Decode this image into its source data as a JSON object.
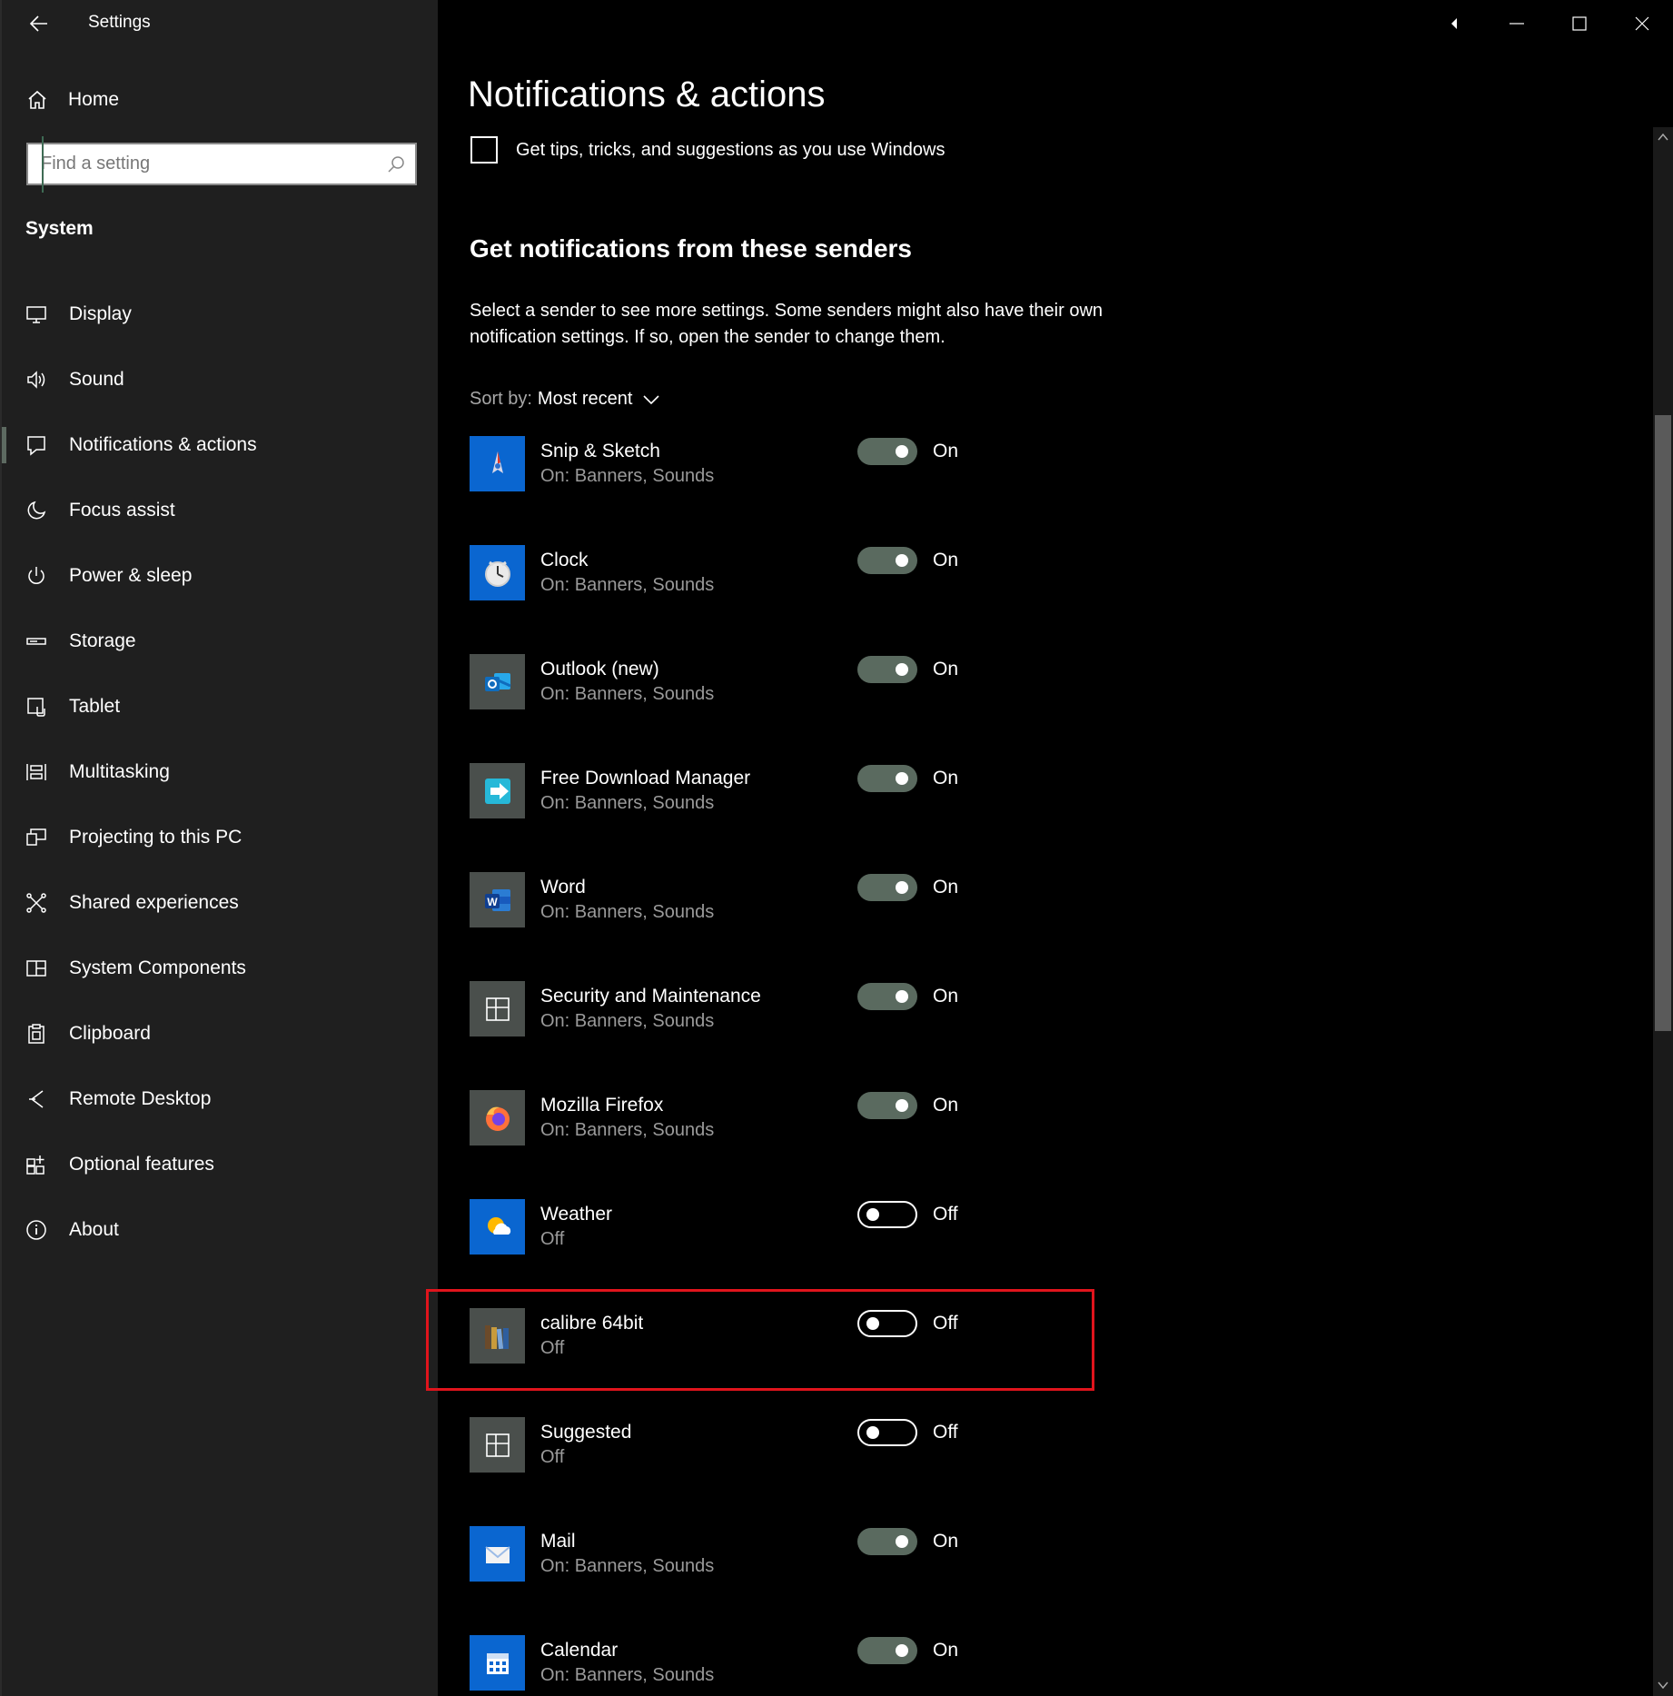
{
  "window": {
    "title": "Settings"
  },
  "nav": {
    "home_label": "Home",
    "search_placeholder": "Find a setting",
    "section": "System",
    "items": [
      {
        "label": "Display",
        "icon": "display-icon"
      },
      {
        "label": "Sound",
        "icon": "speaker-icon"
      },
      {
        "label": "Notifications & actions",
        "icon": "notification-icon",
        "selected": true
      },
      {
        "label": "Focus assist",
        "icon": "moon-icon"
      },
      {
        "label": "Power & sleep",
        "icon": "power-icon"
      },
      {
        "label": "Storage",
        "icon": "storage-icon"
      },
      {
        "label": "Tablet",
        "icon": "tablet-icon"
      },
      {
        "label": "Multitasking",
        "icon": "multitasking-icon"
      },
      {
        "label": "Projecting to this PC",
        "icon": "projecting-icon"
      },
      {
        "label": "Shared experiences",
        "icon": "shared-experiences-icon"
      },
      {
        "label": "System Components",
        "icon": "system-components-icon"
      },
      {
        "label": "Clipboard",
        "icon": "clipboard-icon"
      },
      {
        "label": "Remote Desktop",
        "icon": "remote-desktop-icon"
      },
      {
        "label": "Optional features",
        "icon": "optional-features-icon"
      },
      {
        "label": "About",
        "icon": "info-icon"
      }
    ]
  },
  "content": {
    "page_title": "Notifications & actions",
    "tips_checkbox_label": "Get tips, tricks, and suggestions as you use Windows",
    "tips_checked": false,
    "senders_heading": "Get notifications from these senders",
    "senders_description": "Select a sender to see more settings. Some senders might also have their own notification settings. If so, open the sender to change them.",
    "sort_prefix": "Sort by:",
    "sort_value": "Most recent",
    "senders": [
      {
        "name": "Snip & Sketch",
        "status": "On: Banners, Sounds",
        "state": "On",
        "on": true,
        "icon": "snip-sketch-icon",
        "icon_bg": "#0a66d0"
      },
      {
        "name": "Clock",
        "status": "On: Banners, Sounds",
        "state": "On",
        "on": true,
        "icon": "clock-icon",
        "icon_bg": "#0a66d0"
      },
      {
        "name": "Outlook (new)",
        "status": "On: Banners, Sounds",
        "state": "On",
        "on": true,
        "icon": "outlook-icon",
        "icon_bg": "#4a4f4c"
      },
      {
        "name": "Free Download Manager",
        "status": "On: Banners, Sounds",
        "state": "On",
        "on": true,
        "icon": "free-download-manager-icon",
        "icon_bg": "#4a4f4c"
      },
      {
        "name": "Word",
        "status": "On: Banners, Sounds",
        "state": "On",
        "on": true,
        "icon": "word-icon",
        "icon_bg": "#4a4f4c"
      },
      {
        "name": "Security and Maintenance",
        "status": "On: Banners, Sounds",
        "state": "On",
        "on": true,
        "icon": "security-maintenance-icon",
        "icon_bg": "#4a4f4c"
      },
      {
        "name": "Mozilla Firefox",
        "status": "On: Banners, Sounds",
        "state": "On",
        "on": true,
        "icon": "firefox-icon",
        "icon_bg": "#4a4f4c"
      },
      {
        "name": "Weather",
        "status": "Off",
        "state": "Off",
        "on": false,
        "icon": "weather-icon",
        "icon_bg": "#0a66d0"
      },
      {
        "name": "calibre 64bit",
        "status": "Off",
        "state": "Off",
        "on": false,
        "icon": "calibre-icon",
        "icon_bg": "#4a4f4c",
        "highlighted": true
      },
      {
        "name": "Suggested",
        "status": "Off",
        "state": "Off",
        "on": false,
        "icon": "suggested-icon",
        "icon_bg": "#4a4f4c"
      },
      {
        "name": "Mail",
        "status": "On: Banners, Sounds",
        "state": "On",
        "on": true,
        "icon": "mail-icon",
        "icon_bg": "#0a66d0"
      },
      {
        "name": "Calendar",
        "status": "On: Banners, Sounds",
        "state": "On",
        "on": true,
        "icon": "calendar-icon",
        "icon_bg": "#0a66d0"
      }
    ]
  },
  "colors": {
    "nav_bg": "#1f1f1f",
    "content_bg": "#000000",
    "toggle_on": "#5a6a5f",
    "highlight": "#e0141c",
    "secondary_text": "#9a9a9a"
  }
}
